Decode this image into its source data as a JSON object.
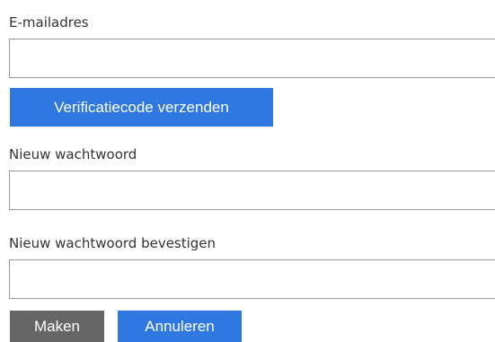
{
  "form": {
    "email": {
      "label": "E-mailadres",
      "value": "",
      "placeholder": ""
    },
    "send_code_label": "Verificatiecode verzenden",
    "new_password": {
      "label": "Nieuw wachtwoord",
      "value": "",
      "placeholder": ""
    },
    "confirm_password": {
      "label": "Nieuw wachtwoord bevestigen",
      "value": "",
      "placeholder": ""
    },
    "create_label": "Maken",
    "cancel_label": "Annuleren"
  },
  "colors": {
    "primary_button": "#2f78e2",
    "disabled_button": "#666666",
    "field_border": "#9a9a9a",
    "text": "#333333"
  }
}
